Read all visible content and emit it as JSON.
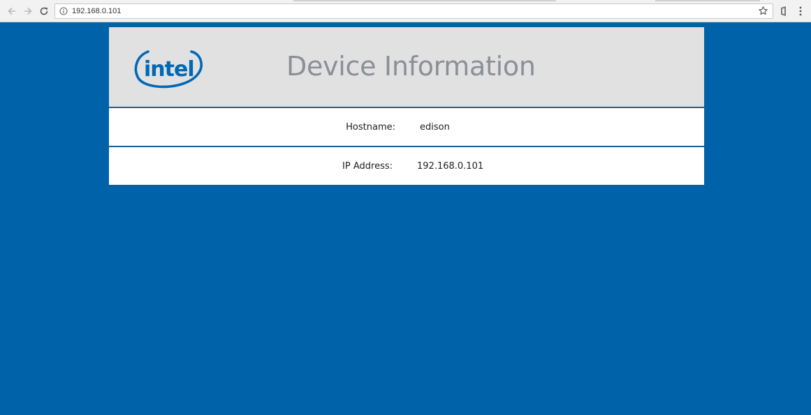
{
  "browser": {
    "address_value": "192.168.0.101",
    "icons": {
      "back": "arrow-left-icon",
      "forward": "arrow-right-icon",
      "reload": "reload-icon",
      "site_info": "info-icon",
      "bookmark": "star-icon",
      "extension": "extension-icon",
      "menu": "more-vert-icon"
    }
  },
  "page": {
    "logo_text": "intel",
    "title": "Device Information",
    "rows": [
      {
        "label": "Hostname:",
        "value": "edison"
      },
      {
        "label": "IP Address:",
        "value": "192.168.0.101"
      }
    ]
  },
  "colors": {
    "background": "#0063aa",
    "header_bg": "#e1e1e1",
    "divider": "#1e5d96",
    "title": "#8b8f96",
    "intel_blue": "#0068b5"
  }
}
